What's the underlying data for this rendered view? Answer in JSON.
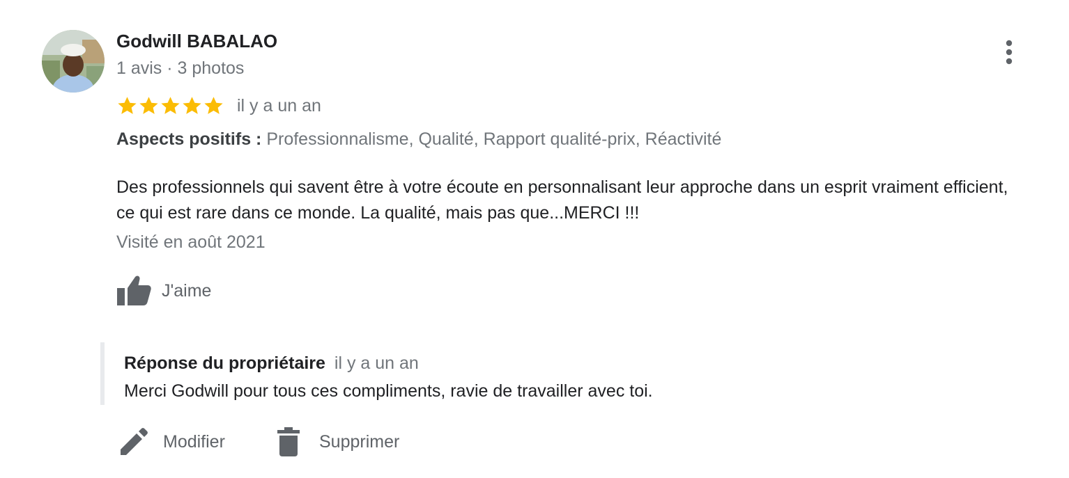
{
  "review": {
    "author_name": "Godwill BABALAO",
    "author_meta": "1 avis · 3 photos",
    "rating": 5,
    "rating_max": 5,
    "star_color": "#fbbc04",
    "date": "il y a un an",
    "aspects_label": "Aspects positifs :",
    "aspects_values": "Professionnalisme, Qualité, Rapport qualité-prix, Réactivité",
    "text": "Des professionnels qui savent être à votre écoute en personnalisant leur approche dans un esprit vraiment efficient, ce qui est rare dans ce monde. La qualité, mais pas que...MERCI !!!",
    "visit": "Visité en août 2021",
    "like_label": "J'aime"
  },
  "owner_response": {
    "title": "Réponse du propriétaire",
    "date": "il y a un an",
    "text": "Merci Godwill pour tous ces compliments, ravie de travailler avec toi."
  },
  "actions": {
    "edit_label": "Modifier",
    "delete_label": "Supprimer"
  },
  "icons": {
    "avatar": "avatar",
    "more": "more-vert-icon",
    "star": "star-icon",
    "like": "thumb-up-icon",
    "edit": "pencil-icon",
    "delete": "trash-icon"
  },
  "colors": {
    "text_primary": "#202124",
    "text_secondary": "#70757a",
    "icon_gray": "#5f6368",
    "reply_border": "#e8eaed"
  }
}
